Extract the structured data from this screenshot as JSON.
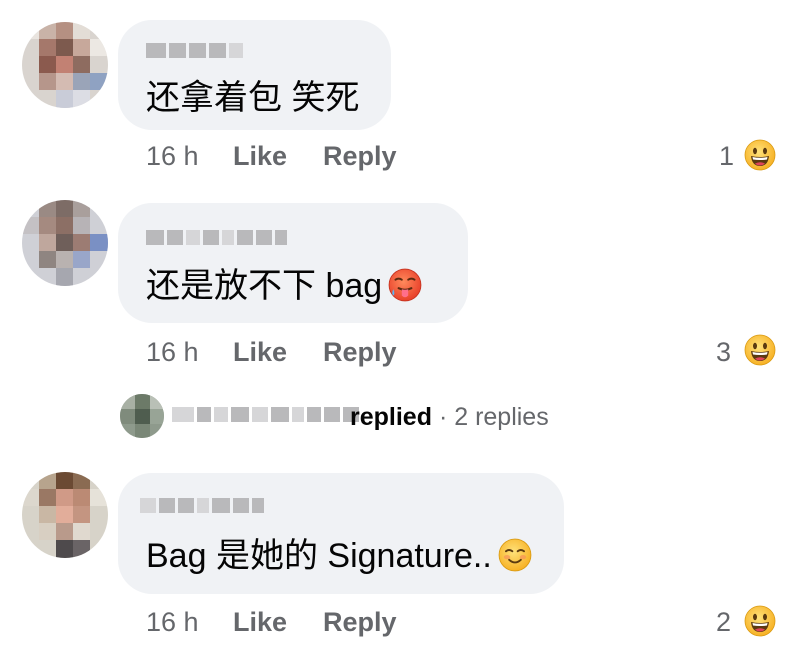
{
  "comments": [
    {
      "text": "还拿着包 笑死",
      "time": "16 h",
      "like_label": "Like",
      "reply_label": "Reply",
      "reaction_count": "1",
      "reaction_icon": "grinning-face-icon",
      "avatar": "blurred-avatar"
    },
    {
      "text": "还是放不下 bag",
      "text_emoji": "hot-face-icon",
      "time": "16 h",
      "like_label": "Like",
      "reply_label": "Reply",
      "reaction_count": "3",
      "reaction_icon": "grinning-face-icon",
      "replies": {
        "replied_label": "replied",
        "separator": "·",
        "count_label": "2 replies"
      }
    },
    {
      "text": "Bag 是她的 Signature..",
      "text_emoji": "smiling-face-icon",
      "time": "16 h",
      "like_label": "Like",
      "reply_label": "Reply",
      "reaction_count": "2",
      "reaction_icon": "grinning-face-icon"
    }
  ],
  "colors": {
    "bubble": "#f0f2f5",
    "secondary_text": "#65676b",
    "primary_text": "#050505",
    "reaction_yellow": "#ffcc3d"
  }
}
